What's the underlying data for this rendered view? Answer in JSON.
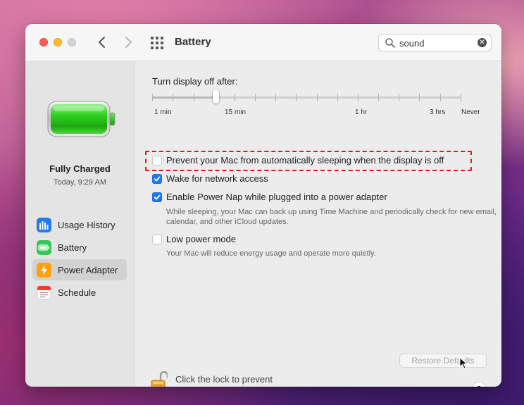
{
  "window": {
    "title": "Battery"
  },
  "search": {
    "value": "sound"
  },
  "sidebar": {
    "status_title": "Fully Charged",
    "status_time": "Today, 9:29 AM",
    "items": [
      {
        "label": "Usage History",
        "icon": "usage-history-icon"
      },
      {
        "label": "Battery",
        "icon": "battery-icon"
      },
      {
        "label": "Power Adapter",
        "icon": "power-adapter-icon",
        "selected": true
      },
      {
        "label": "Schedule",
        "icon": "schedule-icon"
      }
    ]
  },
  "display_off": {
    "label": "Turn display off after:",
    "tick_labels": [
      "1 min",
      "15 min",
      "1 hr",
      "3 hrs",
      "Never"
    ],
    "value": "15 min"
  },
  "options": [
    {
      "label": "Prevent your Mac from automatically sleeping when the display is off",
      "checked": false,
      "highlighted": true
    },
    {
      "label": "Wake for network access",
      "checked": true
    },
    {
      "label": "Enable Power Nap while plugged into a power adapter",
      "checked": true,
      "description": "While sleeping, your Mac can back up using Time Machine and periodically check for new email, calendar, and other iCloud updates."
    },
    {
      "label": "Low power mode",
      "checked": false,
      "description": "Your Mac will reduce energy usage and operate more quietly."
    }
  ],
  "restore_label": "Restore Defaults",
  "lock_text": "Click the lock to prevent further changes.",
  "help_label": "?",
  "colors": {
    "accent": "#1e79f0",
    "battery_green": "#2fd320",
    "highlight": "#e3151d"
  }
}
